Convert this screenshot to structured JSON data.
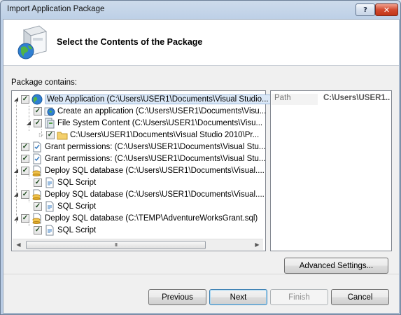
{
  "window": {
    "title": "Import Application Package",
    "help_label": "?",
    "close_label": "✕"
  },
  "header": {
    "title": "Select the Contents of the Package",
    "icon": "package-globe-icon"
  },
  "package_label": "Package contains:",
  "tree": [
    {
      "text": "Web Application (C:\\Users\\USER1\\Documents\\Visual Studio...",
      "icon": "globe-icon",
      "selected": true
    },
    {
      "text": "Create an application (C:\\Users\\USER1\\Documents\\Visu...",
      "icon": "app-globe-icon"
    },
    {
      "text": "File System Content (C:\\Users\\USER1\\Documents\\Visu...",
      "icon": "file-system-icon"
    },
    {
      "text": "C:\\Users\\USER1\\Documents\\Visual Studio 2010\\Pr...",
      "icon": "folder-icon"
    },
    {
      "text": "Grant permissions: (C:\\Users\\USER1\\Documents\\Visual Stu...",
      "icon": "document-icon"
    },
    {
      "text": "Grant permissions: (C:\\Users\\USER1\\Documents\\Visual Stu...",
      "icon": "document-icon"
    },
    {
      "text": "Deploy SQL database (C:\\Users\\USER1\\Documents\\Visual....",
      "icon": "database-icon"
    },
    {
      "text": "SQL Script",
      "icon": "script-icon"
    },
    {
      "text": "Deploy SQL database (C:\\Users\\USER1\\Documents\\Visual....",
      "icon": "database-icon"
    },
    {
      "text": "SQL Script",
      "icon": "script-icon"
    },
    {
      "text": "Deploy SQL database (C:\\TEMP\\AdventureWorksGrant.sql)",
      "icon": "database-icon"
    },
    {
      "text": "SQL Script",
      "icon": "script-icon"
    }
  ],
  "scrollbar": {
    "thumb_grip": "III",
    "left_arrow": "◀",
    "right_arrow": "▶"
  },
  "properties": {
    "key": "Path",
    "value": "C:\\Users\\USER1..."
  },
  "buttons": {
    "advanced": "Advanced Settings...",
    "previous": "Previous",
    "next": "Next",
    "finish": "Finish",
    "cancel": "Cancel"
  },
  "colors": {
    "selection": "#dbe8f7",
    "close": "#c23618",
    "title_frame": "#bccfe6"
  }
}
